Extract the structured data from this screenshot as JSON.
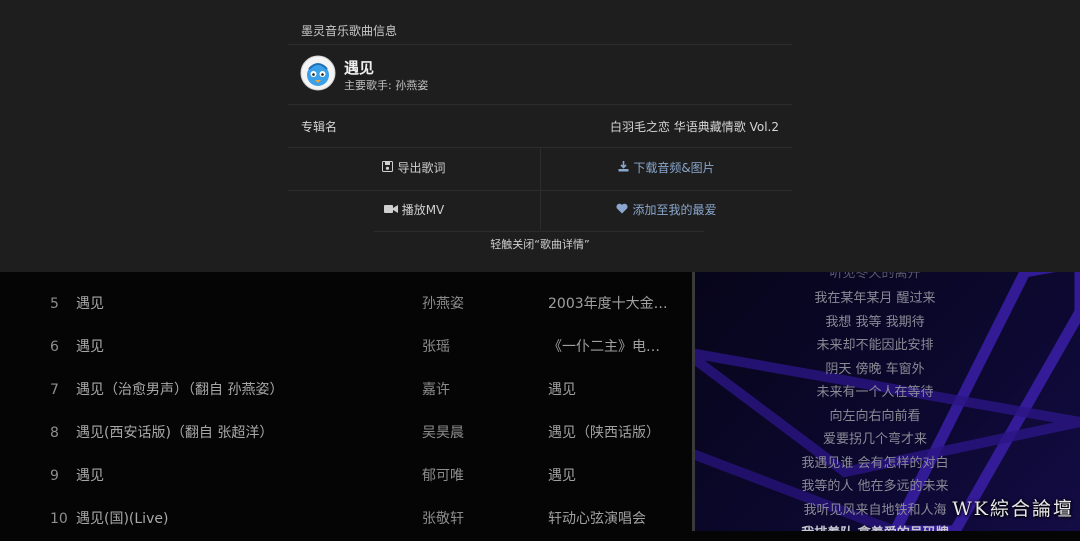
{
  "overlay": {
    "title": "墨灵音乐歌曲信息",
    "song": {
      "name": "遇见",
      "artist_line": "主要歌手: 孙燕姿"
    },
    "album_label": "专辑名",
    "album_value": "白羽毛之恋 华语典藏情歌 Vol.2",
    "buttons": {
      "export_lyrics": "导出歌词",
      "download": "下载音频&图片",
      "play_mv": "播放MV",
      "add_favorite": "添加至我的最爱"
    },
    "close_tip": "轻触关闭“歌曲详情”"
  },
  "songs": [
    {
      "num": "5",
      "title": "遇见",
      "artist": "孙燕姿",
      "album": "2003年度十大金…"
    },
    {
      "num": "6",
      "title": "遇见",
      "artist": "张瑶",
      "album": "《一仆二主》电…"
    },
    {
      "num": "7",
      "title": "遇见（治愈男声）（翻自 孙燕姿）",
      "artist": "嘉许",
      "album": "遇见"
    },
    {
      "num": "8",
      "title": "遇见(西安话版)（翻自 张超洋）",
      "artist": "吴昊晨",
      "album": "遇见（陕西话版）"
    },
    {
      "num": "9",
      "title": "遇见",
      "artist": "郁可唯",
      "album": "遇见"
    },
    {
      "num": "10",
      "title": "遇见(国)(Live)",
      "artist": "张敬轩",
      "album": "轩动心弦演唱会"
    }
  ],
  "lyrics": [
    "听见冬天的离开",
    "我在某年某月 醒过来",
    "我想 我等 我期待",
    "未来却不能因此安排",
    "阴天 傍晚 车窗外",
    "未来有一个人在等待",
    "向左向右向前看",
    "爱要拐几个弯才来",
    "我遇见谁 会有怎样的对白",
    "我等的人 他在多远的未来",
    "我听见风来自地铁和人海",
    "我排着队 拿着爱的号码牌"
  ],
  "watermark": "WK綜合論壇",
  "colors": {
    "accent_blue": "#8aa6cc",
    "panel_bg": "#1e1e1e",
    "lyrics_stripe": "#3b1fa8"
  },
  "icons": [
    "save-icon",
    "download-icon",
    "video-icon",
    "heart-icon",
    "app-logo-icon"
  ]
}
